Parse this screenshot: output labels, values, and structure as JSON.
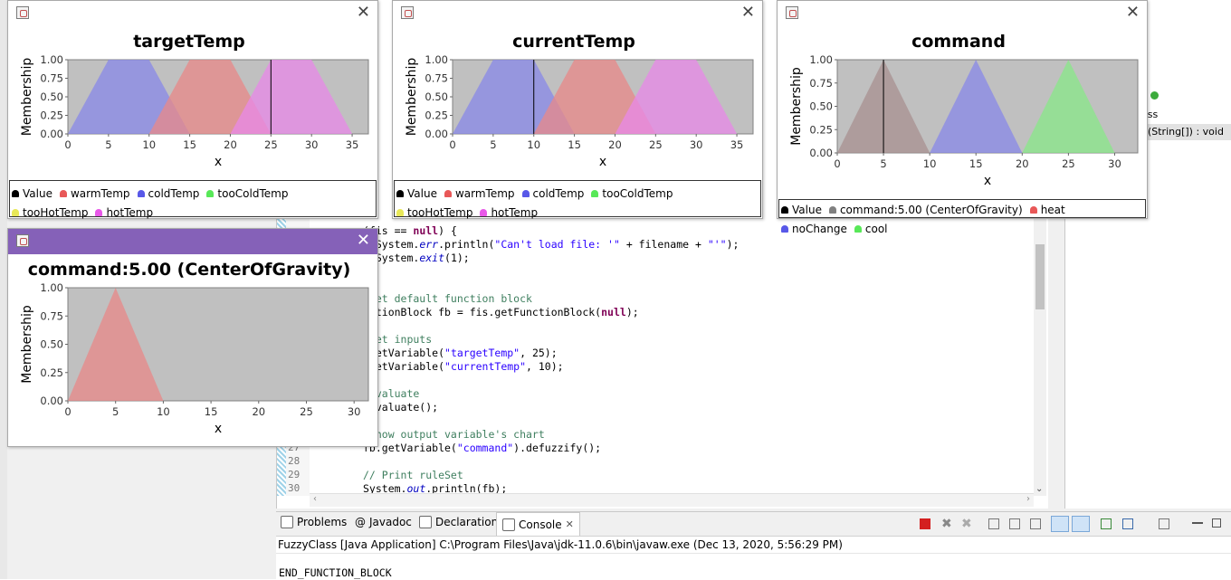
{
  "ide": {
    "window_controls": [
      "□",
      "✕"
    ],
    "outline": {
      "item1": "ass",
      "item2": "n(String[]) : void"
    },
    "code_lines": [
      {
        "num": "",
        "segments": [
          {
            "t": "(fis == ",
            "c": ""
          },
          {
            "t": "null",
            "c": "kw"
          },
          {
            "t": ") {",
            "c": ""
          }
        ]
      },
      {
        "num": "",
        "segments": [
          {
            "t": "  System.",
            "c": ""
          },
          {
            "t": "err",
            "c": "fld"
          },
          {
            "t": ".println(",
            "c": ""
          },
          {
            "t": "\"Can't load file: '\"",
            "c": "str"
          },
          {
            "t": " + filename + ",
            "c": ""
          },
          {
            "t": "\"'\"",
            "c": "str"
          },
          {
            "t": ");",
            "c": ""
          }
        ]
      },
      {
        "num": "",
        "segments": [
          {
            "t": "  System.",
            "c": ""
          },
          {
            "t": "exit",
            "c": "fld"
          },
          {
            "t": "(1);",
            "c": ""
          }
        ]
      },
      {
        "num": "",
        "segments": []
      },
      {
        "num": "",
        "segments": []
      },
      {
        "num": "",
        "segments": [
          {
            "t": " Get default function block",
            "c": "cmt"
          }
        ]
      },
      {
        "num": "",
        "segments": [
          {
            "t": "nctionBlock fb = fis.getFunctionBlock(",
            "c": ""
          },
          {
            "t": "null",
            "c": "kw"
          },
          {
            "t": ");",
            "c": ""
          }
        ]
      },
      {
        "num": "",
        "segments": []
      },
      {
        "num": "",
        "segments": [
          {
            "t": " Set inputs",
            "c": "cmt"
          }
        ]
      },
      {
        "num": "",
        "segments": [
          {
            "t": ".setVariable(",
            "c": ""
          },
          {
            "t": "\"targetTemp\"",
            "c": "str"
          },
          {
            "t": ", 25);",
            "c": ""
          }
        ]
      },
      {
        "num": "",
        "segments": [
          {
            "t": ".setVariable(",
            "c": ""
          },
          {
            "t": "\"currentTemp\"",
            "c": "str"
          },
          {
            "t": ", 10);",
            "c": ""
          }
        ]
      },
      {
        "num": "",
        "segments": []
      },
      {
        "num": "",
        "segments": [
          {
            "t": " Evaluate",
            "c": "cmt"
          }
        ]
      },
      {
        "num": "",
        "segments": [
          {
            "t": ".evaluate();",
            "c": ""
          }
        ]
      },
      {
        "num": "",
        "segments": []
      },
      {
        "num": "",
        "segments": [
          {
            "t": " Show output variable's chart",
            "c": "cmt"
          }
        ]
      },
      {
        "num": "27",
        "segments": [
          {
            "t": "fb.getVariable(",
            "c": ""
          },
          {
            "t": "\"command\"",
            "c": "str"
          },
          {
            "t": ").defuzzify();",
            "c": ""
          }
        ]
      },
      {
        "num": "28",
        "segments": []
      },
      {
        "num": "29",
        "segments": [
          {
            "t": "// Print ruleSet",
            "c": "cmt"
          }
        ]
      },
      {
        "num": "30",
        "segments": [
          {
            "t": "System.",
            "c": ""
          },
          {
            "t": "out",
            "c": "fld"
          },
          {
            "t": ".println(fb);",
            "c": ""
          }
        ]
      }
    ],
    "bottom_tabs": [
      {
        "label": "Problems",
        "icon": "problems-icon"
      },
      {
        "label": "Javadoc",
        "icon": "at-icon"
      },
      {
        "label": "Declaration",
        "icon": "declaration-icon"
      },
      {
        "label": "Console",
        "icon": "console-icon",
        "active": true
      }
    ],
    "console_status": "FuzzyClass [Java Application] C:\\Program Files\\Java\\jdk-11.0.6\\bin\\javaw.exe (Dec 13, 2020, 5:56:29 PM)",
    "console_output": "END_FUNCTION_BLOCK"
  },
  "colors": {
    "warm": "#e88888",
    "cold": "#8888e8",
    "tooCold": "#88e888",
    "tooHot": "#e8e888",
    "hot": "#e888e8",
    "value_dot": "#000000",
    "cog_dot": "#808080",
    "heat": "#e85858",
    "noChange": "#5858e8",
    "cool": "#58e858",
    "plot_bg": "#c0c0c0",
    "purple_title": "#8561b8"
  },
  "windows": [
    {
      "id": "targetTemp",
      "close": "✕"
    },
    {
      "id": "currentTemp",
      "close": "✕"
    },
    {
      "id": "command",
      "close": "✕"
    },
    {
      "id": "cog",
      "close": "✕"
    }
  ],
  "legends": {
    "temp": [
      {
        "label": "Value",
        "color": "#000000"
      },
      {
        "label": "warmTemp",
        "color": "#e85858"
      },
      {
        "label": "coldTemp",
        "color": "#5858e8"
      },
      {
        "label": "tooColdTemp",
        "color": "#58e858"
      },
      {
        "label": "tooHotTemp",
        "color": "#e8e858"
      },
      {
        "label": "hotTemp",
        "color": "#e858e8"
      }
    ],
    "command": [
      {
        "label": "Value",
        "color": "#000000"
      },
      {
        "label": "command:5.00 (CenterOfGravity)",
        "color": "#808080"
      },
      {
        "label": "heat",
        "color": "#e85858"
      },
      {
        "label": "noChange",
        "color": "#5858e8"
      },
      {
        "label": "cool",
        "color": "#58e858"
      }
    ]
  },
  "chart_data": [
    {
      "type": "area",
      "title": "targetTemp",
      "xlabel": "x",
      "ylabel": "Membership",
      "xlim": [
        0,
        37
      ],
      "ylim": [
        0,
        1
      ],
      "x_ticks": [
        "0",
        "5",
        "10",
        "15",
        "20",
        "25",
        "30",
        "35"
      ],
      "y_ticks": [
        "0.00",
        "0.25",
        "0.50",
        "0.75",
        "1.00"
      ],
      "value_line": 25,
      "series": [
        {
          "name": "tooColdTemp",
          "color": "#88e888",
          "points": [
            [
              0,
              1
            ],
            [
              5,
              0
            ]
          ]
        },
        {
          "name": "coldTemp",
          "color": "#8888e8",
          "points": [
            [
              0,
              0
            ],
            [
              5,
              1
            ],
            [
              10,
              1
            ],
            [
              15,
              0
            ]
          ]
        },
        {
          "name": "warmTemp",
          "color": "#e88888",
          "points": [
            [
              10,
              0
            ],
            [
              15,
              1
            ],
            [
              20,
              1
            ],
            [
              25,
              0
            ]
          ]
        },
        {
          "name": "hotTemp",
          "color": "#e888e8",
          "points": [
            [
              20,
              0
            ],
            [
              25,
              1
            ],
            [
              30,
              1
            ],
            [
              35,
              0
            ]
          ]
        },
        {
          "name": "tooHotTemp",
          "color": "#e8e888",
          "points": [
            [
              30,
              0
            ],
            [
              35,
              1
            ]
          ]
        }
      ]
    },
    {
      "type": "area",
      "title": "currentTemp",
      "xlabel": "x",
      "ylabel": "Membership",
      "xlim": [
        0,
        37
      ],
      "ylim": [
        0,
        1
      ],
      "x_ticks": [
        "0",
        "5",
        "10",
        "15",
        "20",
        "25",
        "30",
        "35"
      ],
      "y_ticks": [
        "0.00",
        "0.25",
        "0.50",
        "0.75",
        "1.00"
      ],
      "value_line": 10,
      "series": [
        {
          "name": "tooColdTemp",
          "color": "#88e888",
          "points": [
            [
              0,
              1
            ],
            [
              5,
              0
            ]
          ]
        },
        {
          "name": "coldTemp",
          "color": "#8888e8",
          "points": [
            [
              0,
              0
            ],
            [
              5,
              1
            ],
            [
              10,
              1
            ],
            [
              15,
              0
            ]
          ]
        },
        {
          "name": "warmTemp",
          "color": "#e88888",
          "points": [
            [
              10,
              0
            ],
            [
              15,
              1
            ],
            [
              20,
              1
            ],
            [
              25,
              0
            ]
          ]
        },
        {
          "name": "hotTemp",
          "color": "#e888e8",
          "points": [
            [
              20,
              0
            ],
            [
              25,
              1
            ],
            [
              30,
              1
            ],
            [
              35,
              0
            ]
          ]
        },
        {
          "name": "tooHotTemp",
          "color": "#e8e888",
          "points": [
            [
              30,
              0
            ],
            [
              35,
              1
            ]
          ]
        }
      ]
    },
    {
      "type": "area",
      "title": "command",
      "xlabel": "x",
      "ylabel": "Membership",
      "xlim": [
        0,
        32.5
      ],
      "ylim": [
        0,
        1
      ],
      "x_ticks": [
        "0",
        "5",
        "10",
        "15",
        "20",
        "25",
        "30"
      ],
      "y_ticks": [
        "0.00",
        "0.25",
        "0.50",
        "0.75",
        "1.00"
      ],
      "value_line": 5,
      "series": [
        {
          "name": "command:5.00 (CenterOfGravity)",
          "color": "#a89090",
          "points": [
            [
              0,
              0
            ],
            [
              5,
              1
            ],
            [
              10,
              0
            ]
          ]
        },
        {
          "name": "noChange",
          "color": "#8888e8",
          "points": [
            [
              10,
              0
            ],
            [
              15,
              1
            ],
            [
              20,
              0
            ]
          ]
        },
        {
          "name": "cool",
          "color": "#88e888",
          "points": [
            [
              20,
              0
            ],
            [
              25,
              1
            ],
            [
              30,
              0
            ]
          ]
        }
      ]
    },
    {
      "type": "area",
      "title": "command:5.00 (CenterOfGravity)",
      "xlabel": "x",
      "ylabel": "Membership",
      "xlim": [
        0,
        31.5
      ],
      "ylim": [
        0,
        1
      ],
      "x_ticks": [
        "0",
        "5",
        "10",
        "15",
        "20",
        "25",
        "30"
      ],
      "y_ticks": [
        "0.00",
        "0.25",
        "0.50",
        "0.75",
        "1.00"
      ],
      "value_line": null,
      "series": [
        {
          "name": "heat",
          "color": "#e88888",
          "points": [
            [
              0,
              0
            ],
            [
              5,
              1
            ],
            [
              10,
              0
            ]
          ]
        }
      ]
    }
  ]
}
